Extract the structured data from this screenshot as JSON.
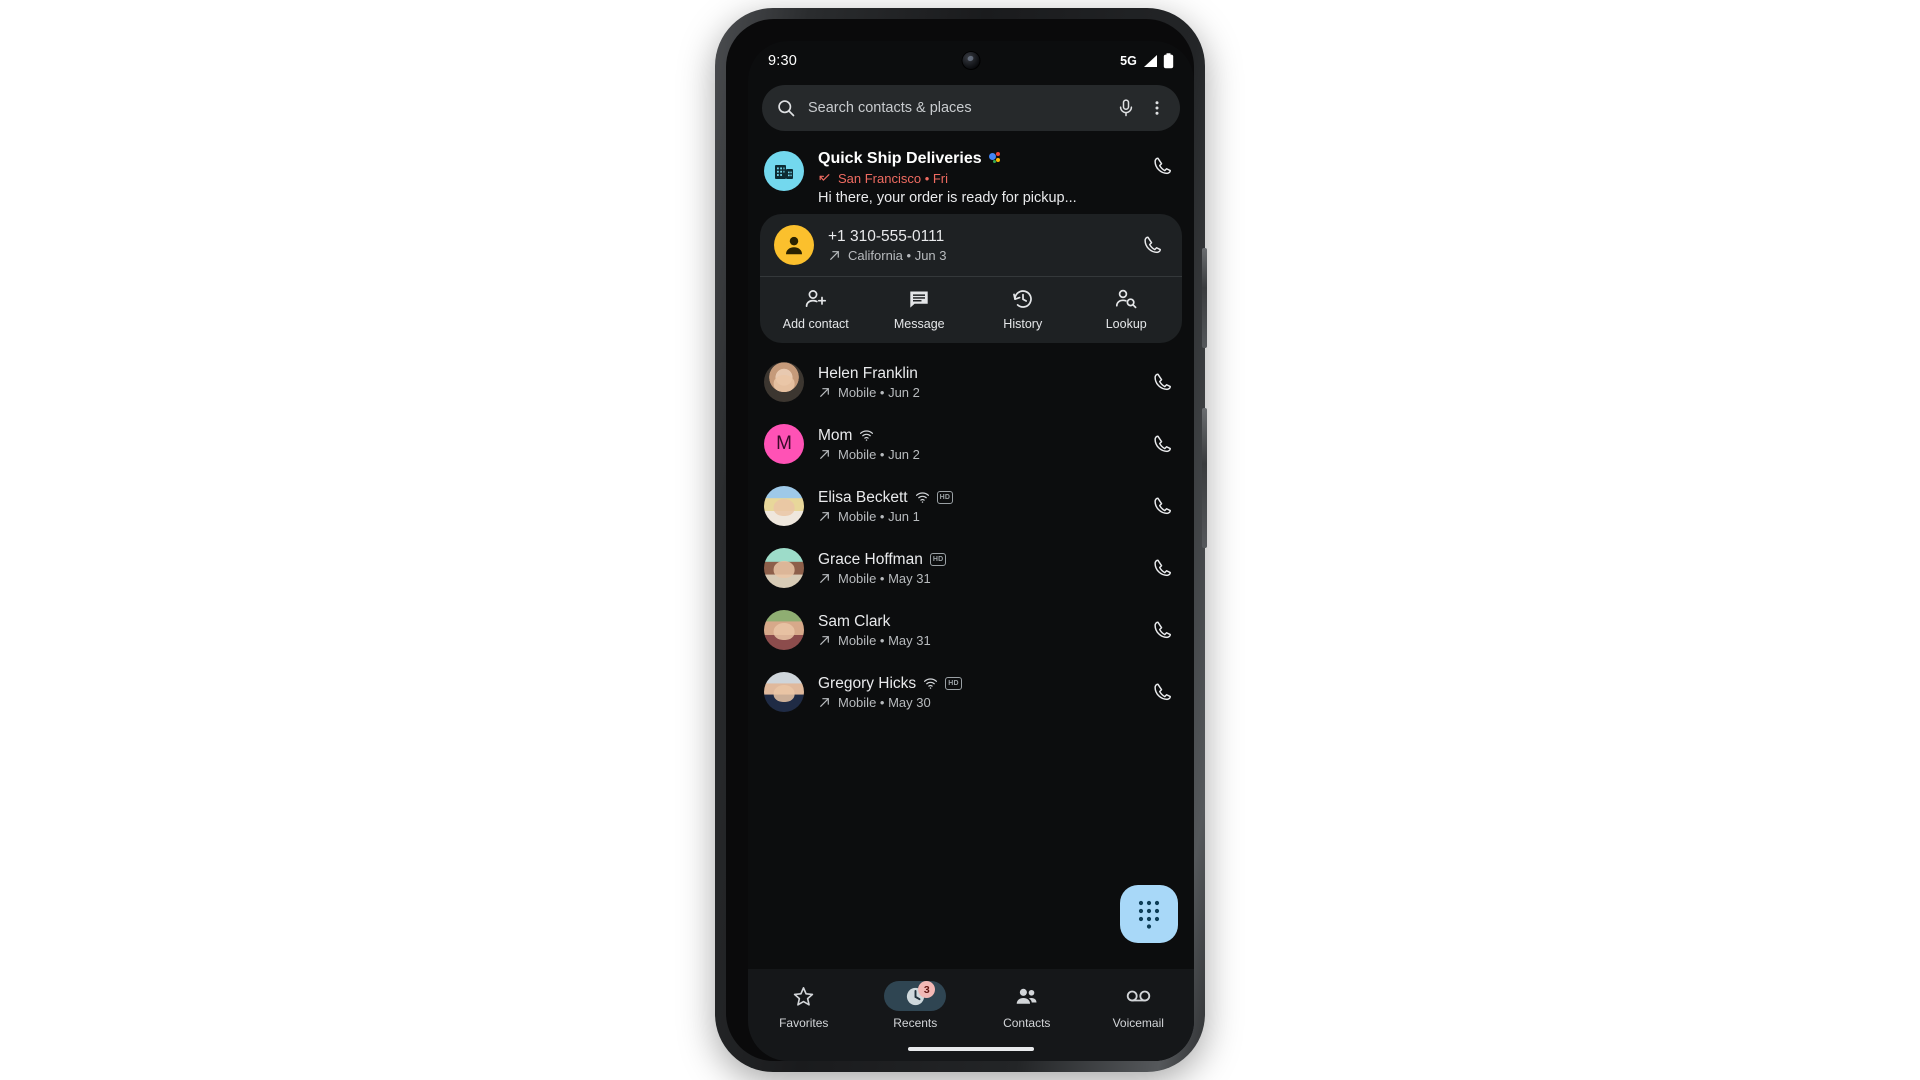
{
  "status_bar": {
    "time": "9:30",
    "network": "5G",
    "signal_icon": "signal-bars-icon",
    "battery_icon": "battery-full-icon"
  },
  "search": {
    "placeholder": "Search contacts & places",
    "search_icon": "search-icon",
    "mic_icon": "microphone-icon",
    "overflow_icon": "more-vert-icon"
  },
  "business_entry": {
    "name": "Quick Ship Deliveries",
    "assistant_icon": "google-assistant-dots-icon",
    "call_type_icon": "missed-call-icon",
    "location_time": "San Francisco • Fri",
    "snippet": "Hi there, your order is ready for pickup...",
    "avatar_icon": "business-building-icon",
    "avatar_color": "#73d8ee",
    "sub_color": "#ef6b61",
    "call_button_icon": "phone-icon"
  },
  "expanded_entry": {
    "number": "+1 310-555-0111",
    "call_type_icon": "outgoing-call-icon",
    "location_date": "California • Jun 3",
    "avatar_icon": "person-icon",
    "avatar_color": "#fbc02d",
    "call_button_icon": "phone-icon",
    "actions": [
      {
        "label": "Add contact",
        "icon": "person-add-icon"
      },
      {
        "label": "Message",
        "icon": "message-icon"
      },
      {
        "label": "History",
        "icon": "history-clock-icon"
      },
      {
        "label": "Lookup",
        "icon": "person-search-icon"
      }
    ]
  },
  "call_log": [
    {
      "name": "Helen Franklin",
      "call_type_icon": "outgoing-call-icon",
      "detail": "Mobile • Jun 2",
      "wifi_call": false,
      "hd_badge": false,
      "avatar_kind": "photo",
      "avatar_class": "ph-helen",
      "call_button_icon": "phone-icon"
    },
    {
      "name": "Mom",
      "call_type_icon": "outgoing-call-icon",
      "detail": "Mobile • Jun 2",
      "wifi_call": true,
      "hd_badge": false,
      "avatar_kind": "letter",
      "avatar_letter": "M",
      "avatar_color": "#ff52b5",
      "call_button_icon": "phone-icon"
    },
    {
      "name": "Elisa Beckett",
      "call_type_icon": "outgoing-call-icon",
      "detail": "Mobile • Jun 1",
      "wifi_call": true,
      "hd_badge": true,
      "hd_label": "HD",
      "avatar_kind": "photo",
      "avatar_class": "ph-elisa",
      "call_button_icon": "phone-icon"
    },
    {
      "name": "Grace Hoffman",
      "call_type_icon": "outgoing-call-icon",
      "detail": "Mobile • May 31",
      "wifi_call": false,
      "hd_badge": true,
      "hd_label": "HD",
      "avatar_kind": "photo",
      "avatar_class": "ph-grace",
      "call_button_icon": "phone-icon"
    },
    {
      "name": "Sam Clark",
      "call_type_icon": "outgoing-call-icon",
      "detail": "Mobile • May 31",
      "wifi_call": false,
      "hd_badge": false,
      "avatar_kind": "photo",
      "avatar_class": "ph-sam",
      "call_button_icon": "phone-icon"
    },
    {
      "name": "Gregory Hicks",
      "call_type_icon": "outgoing-call-icon",
      "detail": "Mobile • May 30",
      "wifi_call": true,
      "hd_badge": true,
      "hd_label": "HD",
      "avatar_kind": "photo",
      "avatar_class": "ph-gregory",
      "call_button_icon": "phone-icon"
    }
  ],
  "fab": {
    "icon": "dialpad-icon",
    "color": "#a8d8f8"
  },
  "bottom_nav": {
    "items": [
      {
        "label": "Favorites",
        "icon": "star-icon",
        "active": false,
        "badge": null
      },
      {
        "label": "Recents",
        "icon": "clock-icon",
        "active": true,
        "badge": "3"
      },
      {
        "label": "Contacts",
        "icon": "people-icon",
        "active": false,
        "badge": null
      },
      {
        "label": "Voicemail",
        "icon": "voicemail-icon",
        "active": false,
        "badge": null
      }
    ]
  },
  "colors": {
    "screen_bg": "#0c0d0e",
    "search_bg": "#26292b",
    "card_bg": "#1e2123",
    "nav_bg": "#151719",
    "accent_blue": "#a8d8f8",
    "accent_red": "#ef6b61",
    "nav_active_pill": "#2f4552",
    "badge_bg": "#f2b8b5"
  }
}
